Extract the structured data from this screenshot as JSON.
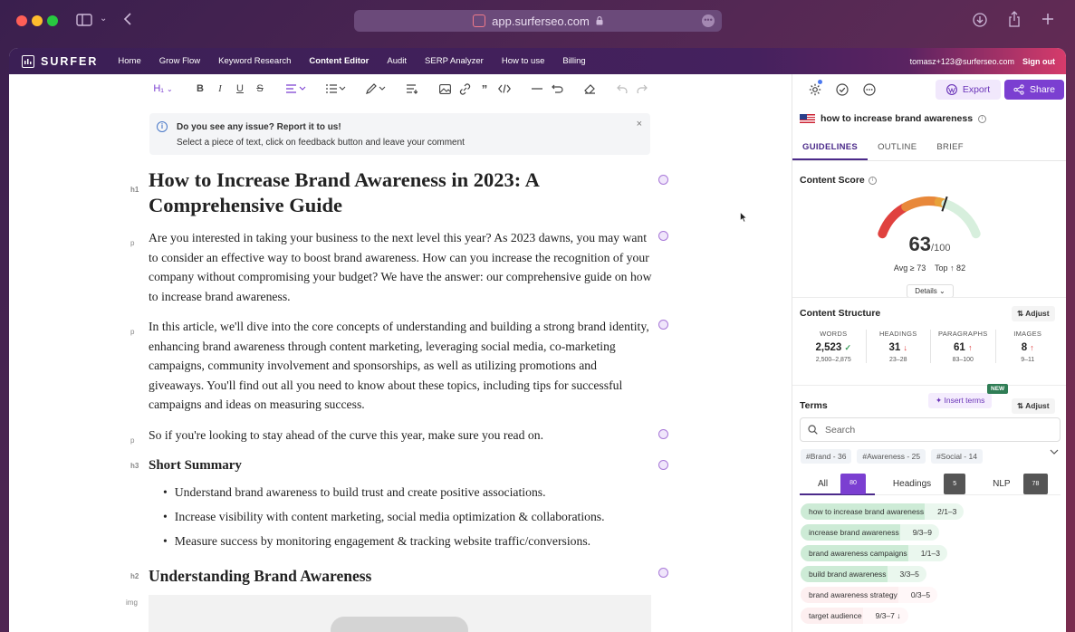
{
  "browser": {
    "url": "app.surferseo.com"
  },
  "nav": {
    "brand": "SURFER",
    "links": [
      "Home",
      "Grow Flow",
      "Keyword Research",
      "Content Editor",
      "Audit",
      "SERP Analyzer",
      "How to use",
      "Billing"
    ],
    "active": "Content Editor",
    "user": "tomasz+123@surferseo.com",
    "signout": "Sign out"
  },
  "toolbar": {
    "heading_select": "H₁"
  },
  "banner": {
    "title": "Do you see any issue? Report it to us!",
    "text": "Select a piece of text, click on feedback button and leave your comment"
  },
  "editor": {
    "tags": {
      "h1": "h1",
      "p": "p",
      "h3": "h3",
      "h2": "h2",
      "img": "img"
    },
    "h1": "How to Increase Brand Awareness in 2023: A Comprehensive Guide",
    "p1": "Are you interested in taking your business to the next level this year? As 2023 dawns, you may want to consider an effective way to boost brand awareness. How can you increase the recognition of your company without compromising your budget? We have the answer: our comprehensive guide on how to increase brand awareness.",
    "p2": "In this article, we'll dive into the core concepts of understanding and building a strong brand identity, enhancing brand awareness through content marketing, leveraging social media, co-marketing campaigns, community involvement and sponsorships, as well as utilizing promotions and giveaways. You'll find out all you need to know about these topics, including tips for successful campaigns and ideas on measuring success.",
    "p3": "So if you're looking to stay ahead of the curve this year, make sure you read on.",
    "h3": "Short Summary",
    "bullets": [
      "Understand brand awareness to build trust and create positive associations.",
      "Increase visibility with content marketing, social media optimization & collaborations.",
      "Measure success by monitoring engagement & tracking website traffic/conversions."
    ],
    "h2": "Understanding Brand Awareness"
  },
  "panel": {
    "export": "Export",
    "share": "Share",
    "keyword": "how to increase brand awareness",
    "tabs": [
      "GUIDELINES",
      "OUTLINE",
      "BRIEF"
    ],
    "content_score_label": "Content Score",
    "score": "63",
    "score_max": "/100",
    "score_value": 63,
    "avg": "Avg ≥ 73",
    "top": "Top ↑ 82",
    "details": "Details",
    "structure_label": "Content Structure",
    "adjust": "Adjust",
    "stats": [
      {
        "label": "WORDS",
        "value": "2,523",
        "mark": "✓",
        "range": "2,500–2,875"
      },
      {
        "label": "HEADINGS",
        "value": "31",
        "mark": "↓",
        "range": "23–28"
      },
      {
        "label": "PARAGRAPHS",
        "value": "61",
        "mark": "↑",
        "range": "83–100"
      },
      {
        "label": "IMAGES",
        "value": "8",
        "mark": "↑",
        "range": "9–11"
      }
    ],
    "terms_label": "Terms",
    "insert_terms": "Insert terms",
    "new_badge": "NEW",
    "search_placeholder": "Search",
    "chips": [
      "#Brand - 36",
      "#Awareness - 25",
      "#Social - 14"
    ],
    "filter_tabs": [
      {
        "label": "All",
        "count": "80"
      },
      {
        "label": "Headings",
        "count": "5"
      },
      {
        "label": "NLP",
        "count": "78"
      }
    ],
    "terms": [
      {
        "name": "how to increase brand awareness",
        "count": "2/1–3",
        "status": "ok"
      },
      {
        "name": "increase brand awareness",
        "count": "9/3–9",
        "status": "ok"
      },
      {
        "name": "brand awareness campaigns",
        "count": "1/1–3",
        "status": "ok"
      },
      {
        "name": "build brand awareness",
        "count": "3/3–5",
        "status": "ok"
      },
      {
        "name": "brand awareness strategy",
        "count": "0/3–5",
        "status": "missing"
      },
      {
        "name": "target audience",
        "count": "9/3–7 ↓",
        "status": "over"
      }
    ]
  }
}
